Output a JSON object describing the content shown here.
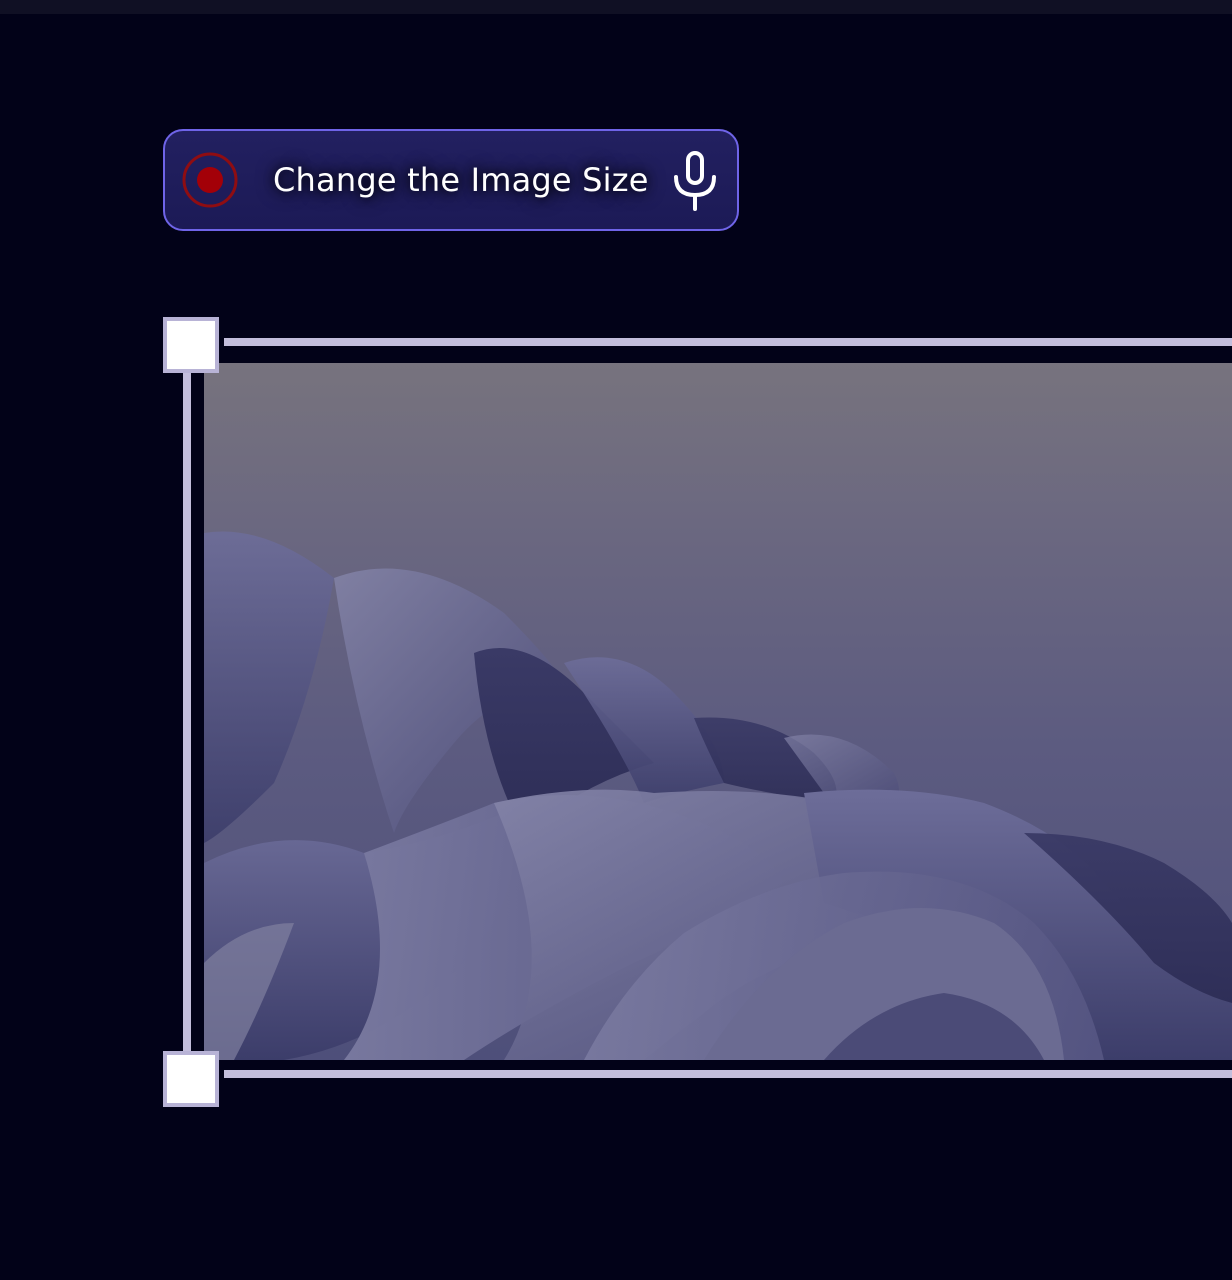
{
  "voice_command": {
    "text": "Change the Image Size",
    "record_icon": "record-icon",
    "mic_icon": "microphone-icon"
  },
  "colors": {
    "background": "#020218",
    "pill_border": "#6f64e8",
    "pill_fill": "#1f1d5a",
    "record_red": "#a00000",
    "selection": "#c3bedc"
  },
  "image": {
    "description_icon": "wallpaper-image",
    "handles": [
      "top-left",
      "bottom-left"
    ]
  }
}
